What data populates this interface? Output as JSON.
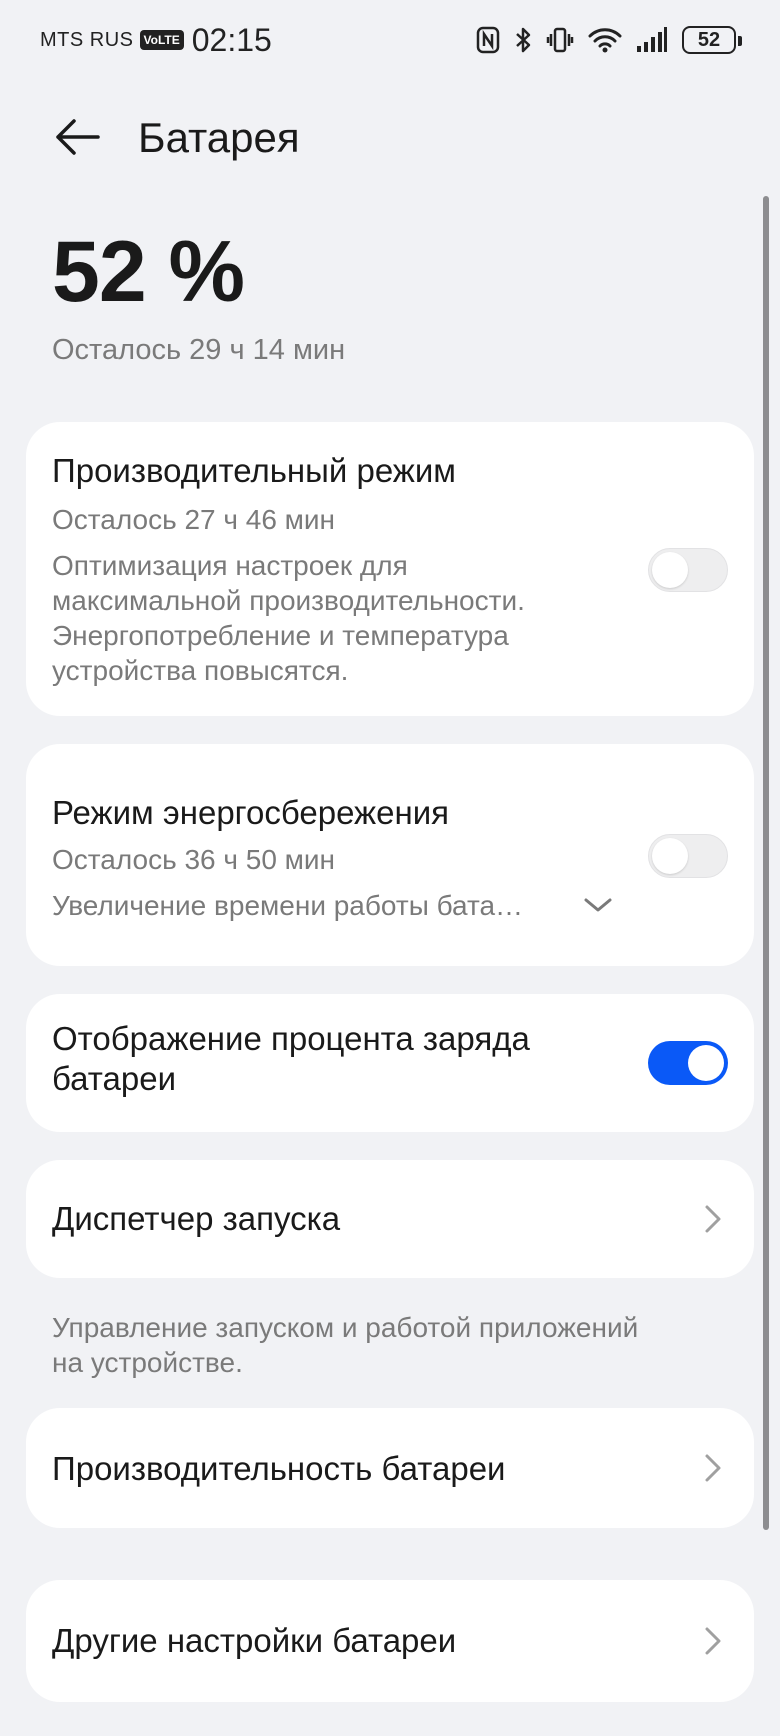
{
  "status_bar": {
    "carrier": "MTS RUS",
    "volte": "VoLTE",
    "time": "02:15",
    "icons": [
      "nfc-icon",
      "bluetooth-icon",
      "vibrate-icon",
      "wifi-icon",
      "signal-icon"
    ],
    "battery_level": "52"
  },
  "header": {
    "title": "Батарея"
  },
  "summary": {
    "percent": "52 %",
    "remaining": "Осталось 29 ч 14 мин"
  },
  "performance_mode": {
    "title": "Производительный режим",
    "remaining": "Осталось 27 ч 46 мин",
    "description_lines": [
      "Оптимизация настроек для",
      "максимальной производительности.",
      "Энергопотребление и температура",
      "устройства повысятся."
    ],
    "enabled": false
  },
  "power_saving": {
    "title": "Режим энергосбережения",
    "remaining": "Осталось 36 ч 50 мин",
    "description": "Увеличение времени работы бата…",
    "enabled": false
  },
  "show_percentage": {
    "title_lines": [
      "Отображение процента заряда",
      "батареи"
    ],
    "enabled": true
  },
  "launch_manager": {
    "title": "Диспетчер запуска",
    "footnote_lines": [
      "Управление запуском и работой приложений",
      "на устройстве."
    ]
  },
  "battery_performance": {
    "title": "Производительность батареи"
  },
  "other_settings": {
    "title": "Другие настройки батареи"
  },
  "colors": {
    "accent": "#0a59f7",
    "background": "#f1f2f5",
    "card": "#ffffff",
    "secondary_text": "#7a7a7a"
  }
}
